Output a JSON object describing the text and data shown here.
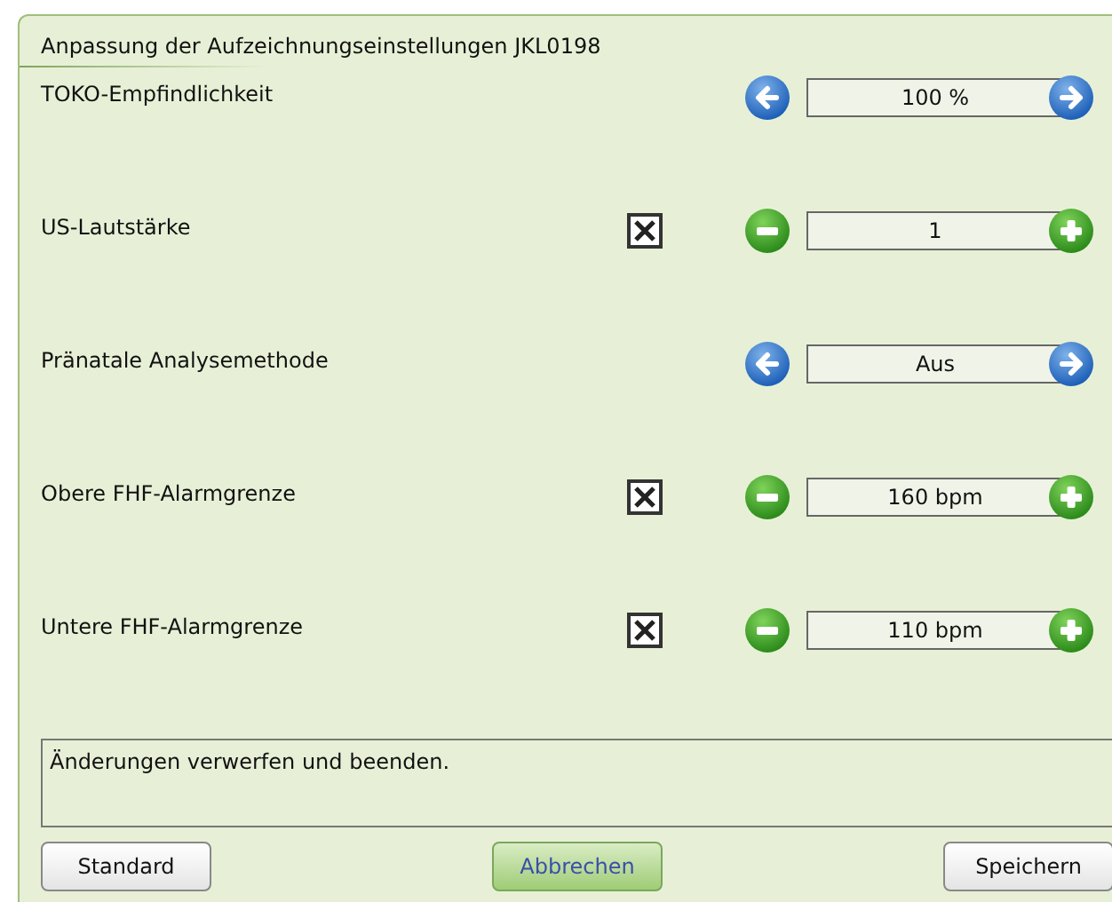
{
  "dialog": {
    "title": "Anpassung der Aufzeichnungseinstellungen JKL0198"
  },
  "settings": [
    {
      "label": "TOKO-Empfindlichkeit",
      "kind": "arrows",
      "value": "100 %"
    },
    {
      "label": "US-Lautstärke",
      "kind": "stepper",
      "checked": true,
      "value": "1"
    },
    {
      "label": "Pränatale Analysemethode",
      "kind": "arrows",
      "value": "Aus"
    },
    {
      "label": "Obere FHF-Alarmgrenze",
      "kind": "stepper",
      "checked": true,
      "value": "160 bpm"
    },
    {
      "label": "Untere FHF-Alarmgrenze",
      "kind": "stepper",
      "checked": true,
      "value": "110 bpm"
    }
  ],
  "description": "Änderungen verwerfen und beenden.",
  "buttons": [
    {
      "label": "Standard",
      "selected": false
    },
    {
      "label": "Abbrechen",
      "selected": true
    },
    {
      "label": "Speichern",
      "selected": false
    }
  ]
}
